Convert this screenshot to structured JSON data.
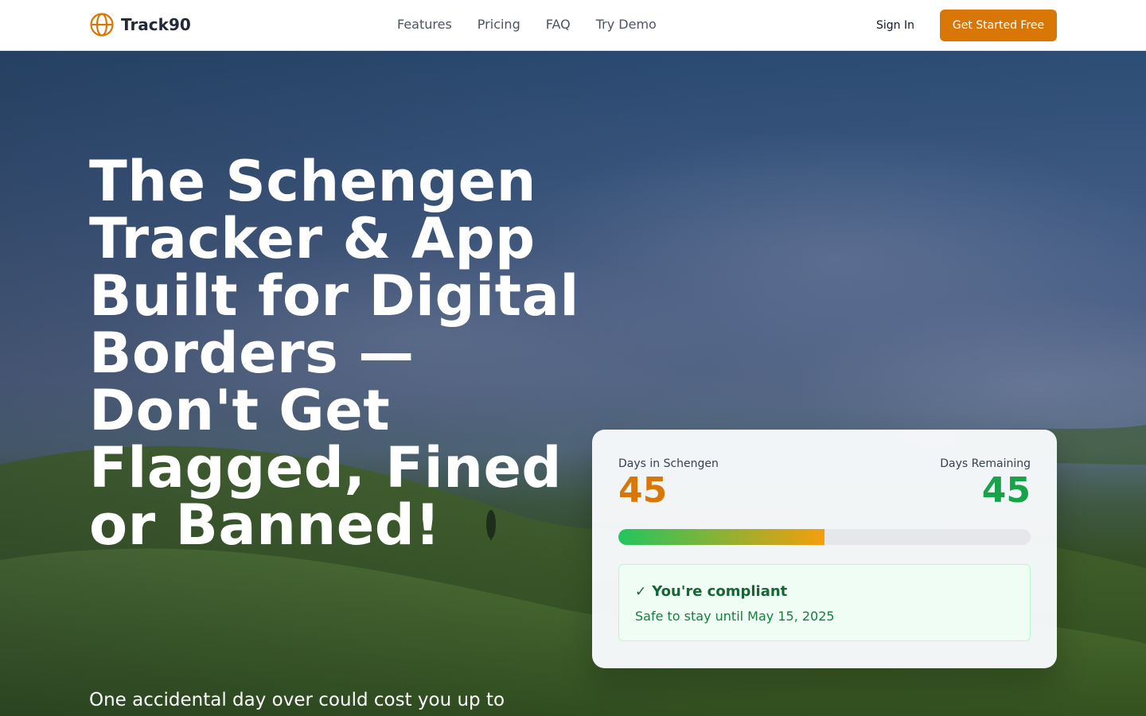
{
  "brand": {
    "name": "Track90",
    "icon": "globe-icon",
    "color": "#d97706"
  },
  "nav": {
    "items": [
      {
        "label": "Features"
      },
      {
        "label": "Pricing"
      },
      {
        "label": "FAQ"
      },
      {
        "label": "Try Demo"
      }
    ]
  },
  "header": {
    "signin_label": "Sign In",
    "cta_label": "Get Started Free"
  },
  "hero": {
    "title": "The Schengen Tracker & App Built for Digital Borders — Don't Get Flagged, Fined or Banned!",
    "subtitle": "One accidental day over could cost you up to"
  },
  "card": {
    "days_in_label": "Days in Schengen",
    "days_in_value": "45",
    "days_remaining_label": "Days Remaining",
    "days_remaining_value": "45",
    "progress_fraction": 0.5,
    "status_icon": "check-icon",
    "status_check": "✓",
    "status_title": "You're compliant",
    "status_subtitle": "Safe to stay until May 15, 2025"
  },
  "colors": {
    "accent": "#d97706",
    "success": "#16a34a",
    "success_dark": "#166534"
  }
}
